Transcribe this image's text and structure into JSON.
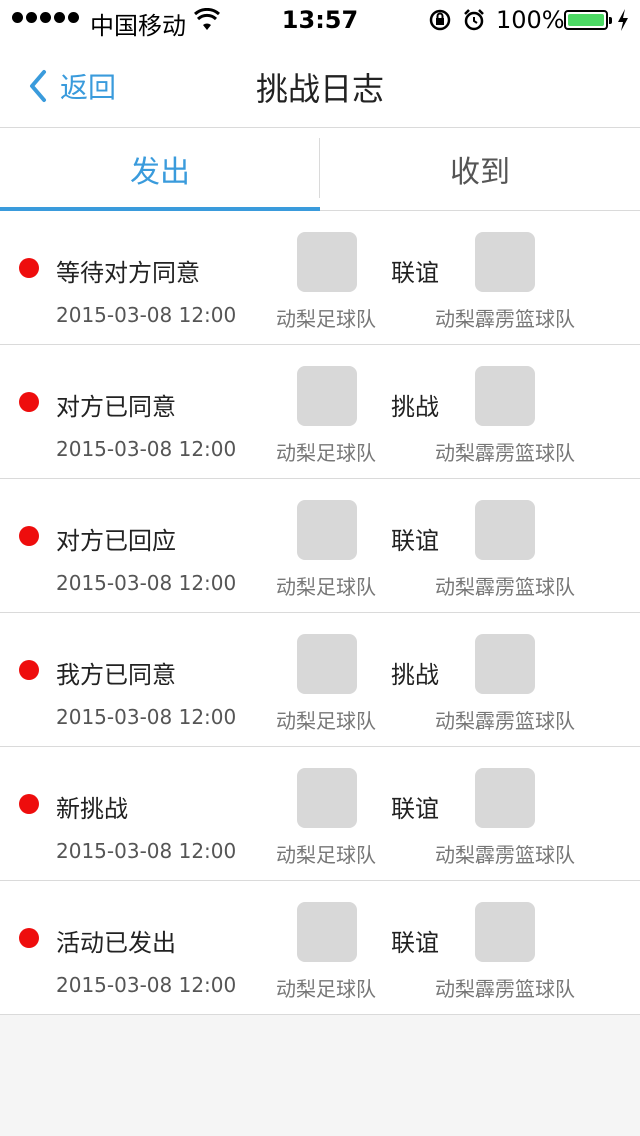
{
  "status_bar": {
    "carrier": "中国移动",
    "time": "13:57",
    "battery": "100%"
  },
  "nav": {
    "back_label": "返回",
    "title": "挑战日志"
  },
  "tabs": [
    {
      "label": "发出",
      "active": true
    },
    {
      "label": "收到",
      "active": false
    }
  ],
  "accent_color": "#3a9bdc",
  "dot_color": "#ee0d0d",
  "rows": [
    {
      "status": "等待对方同意",
      "date": "2015-03-08 12:00",
      "type": "联谊",
      "team1": "动梨足球队",
      "team2": "动梨霹雳篮球队"
    },
    {
      "status": "对方已同意",
      "date": "2015-03-08 12:00",
      "type": "挑战",
      "team1": "动梨足球队",
      "team2": "动梨霹雳篮球队"
    },
    {
      "status": "对方已回应",
      "date": "2015-03-08 12:00",
      "type": "联谊",
      "team1": "动梨足球队",
      "team2": "动梨霹雳篮球队"
    },
    {
      "status": "我方已同意",
      "date": "2015-03-08 12:00",
      "type": "挑战",
      "team1": "动梨足球队",
      "team2": "动梨霹雳篮球队"
    },
    {
      "status": "新挑战",
      "date": "2015-03-08 12:00",
      "type": "联谊",
      "team1": "动梨足球队",
      "team2": "动梨霹雳篮球队"
    },
    {
      "status": "活动已发出",
      "date": "2015-03-08 12:00",
      "type": "联谊",
      "team1": "动梨足球队",
      "team2": "动梨霹雳篮球队"
    }
  ]
}
